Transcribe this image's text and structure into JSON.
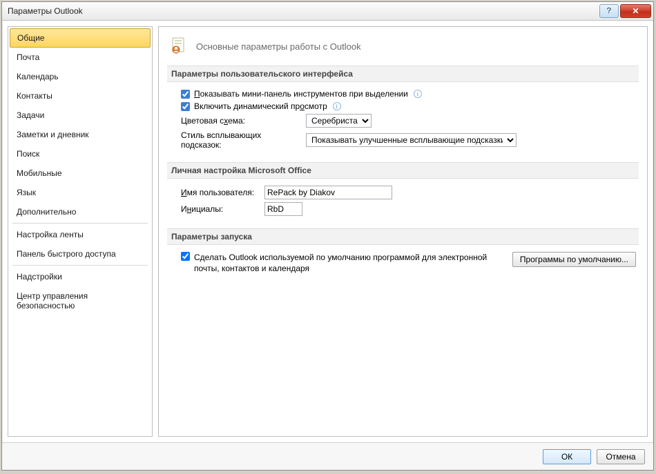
{
  "window": {
    "title": "Параметры Outlook"
  },
  "sidebar": {
    "items": [
      {
        "label": "Общие",
        "selected": true
      },
      {
        "label": "Почта"
      },
      {
        "label": "Календарь"
      },
      {
        "label": "Контакты"
      },
      {
        "label": "Задачи"
      },
      {
        "label": "Заметки и дневник"
      },
      {
        "label": "Поиск"
      },
      {
        "label": "Мобильные"
      },
      {
        "label": "Язык"
      },
      {
        "label": "Дополнительно"
      }
    ],
    "group2": [
      {
        "label": "Настройка ленты"
      },
      {
        "label": "Панель быстрого доступа"
      }
    ],
    "group3": [
      {
        "label": "Надстройки"
      },
      {
        "label": "Центр управления безопасностью"
      }
    ]
  },
  "page": {
    "title": "Основные параметры работы с Outlook"
  },
  "ui_section": {
    "header": "Параметры пользовательского интерфейса",
    "show_minibar_pre": "П",
    "show_minibar_rest": "оказывать мини-панель инструментов при выделении",
    "live_preview_pre": "Включить динамический пр",
    "live_preview_accel": "о",
    "live_preview_rest": "смотр",
    "color_scheme_label_pre": "Цветовая с",
    "color_scheme_label_accel": "х",
    "color_scheme_label_rest": "ема:",
    "color_scheme_value": "Серебристая",
    "tooltip_label": "Стиль всплывающих подсказок:",
    "tooltip_value": "Показывать улучшенные всплывающие подсказки"
  },
  "office_section": {
    "header": "Личная настройка Microsoft Office",
    "username_label_accel": "И",
    "username_label_rest": "мя пользователя:",
    "username_value": "RePack by Diakov",
    "initials_label_pre": "И",
    "initials_label_accel": "н",
    "initials_label_rest": "ициалы:",
    "initials_value": "RbD"
  },
  "startup_section": {
    "header": "Параметры запуска",
    "default_text": "Сделать Outlook используемой по умолчанию программой для электронной почты, контактов и календаря",
    "default_btn": "Программы по умолчанию..."
  },
  "footer": {
    "ok": "ОК",
    "cancel": "Отмена"
  }
}
